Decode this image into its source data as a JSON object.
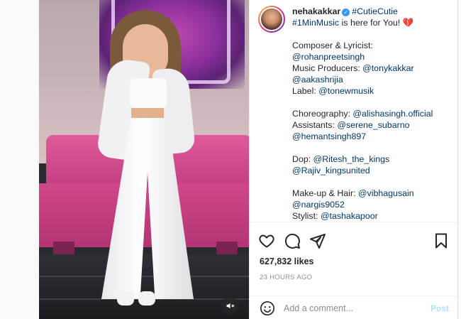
{
  "post": {
    "username": "nehakakkar",
    "verified": true,
    "caption_lines": [
      {
        "parts": [
          {
            "t": "#CutieCutie",
            "tag": true
          }
        ]
      },
      {
        "parts": [
          {
            "t": "#1MinMusic",
            "tag": true
          },
          {
            "t": " is here for You! ",
            "tag": false
          },
          {
            "t": "💔",
            "heart": true
          }
        ]
      },
      {
        "gap": true
      },
      {
        "parts": [
          {
            "t": "Composer & Lyricist:",
            "tag": false
          }
        ]
      },
      {
        "parts": [
          {
            "t": "@rohanpreetsingh",
            "tag": true
          }
        ]
      },
      {
        "parts": [
          {
            "t": "Music Producers: ",
            "tag": false
          },
          {
            "t": "@tonykakkar",
            "tag": true
          }
        ]
      },
      {
        "parts": [
          {
            "t": "@aakashrijia",
            "tag": true
          }
        ]
      },
      {
        "parts": [
          {
            "t": "Label: ",
            "tag": false
          },
          {
            "t": "@tonewmusik",
            "tag": true
          }
        ]
      },
      {
        "gap": true
      },
      {
        "parts": [
          {
            "t": "Choreography: ",
            "tag": false
          },
          {
            "t": "@alishasingh.official",
            "tag": true
          }
        ]
      },
      {
        "parts": [
          {
            "t": "Assistants: ",
            "tag": false
          },
          {
            "t": "@serene_subarno",
            "tag": true
          }
        ]
      },
      {
        "parts": [
          {
            "t": "@hemantsingh897",
            "tag": true
          }
        ]
      },
      {
        "gap": true
      },
      {
        "parts": [
          {
            "t": "Dop: ",
            "tag": false
          },
          {
            "t": "@Ritesh_the_kings",
            "tag": true
          }
        ]
      },
      {
        "parts": [
          {
            "t": "@Rajiv_kingsunited",
            "tag": true
          }
        ]
      },
      {
        "gap": true
      },
      {
        "parts": [
          {
            "t": "Make-up & Hair: ",
            "tag": false
          },
          {
            "t": "@vibhagusain",
            "tag": true
          }
        ]
      },
      {
        "parts": [
          {
            "t": "@nargis9052",
            "tag": true
          }
        ]
      },
      {
        "parts": [
          {
            "t": "Stylist: ",
            "tag": false
          },
          {
            "t": "@tashakapoor",
            "tag": true
          }
        ]
      }
    ]
  },
  "actions": {
    "icons": [
      "heart-icon",
      "comment-icon",
      "share-icon",
      "bookmark-icon"
    ]
  },
  "likes_text": "627,832 likes",
  "time_ago": "23 HOURS AGO",
  "comment": {
    "placeholder": "Add a comment...",
    "post_label": "Post"
  },
  "colors": {
    "link": "#00376b",
    "verified": "#3897f0",
    "post_disabled": "#b2dffc",
    "muted_text": "#8e8e8e"
  }
}
